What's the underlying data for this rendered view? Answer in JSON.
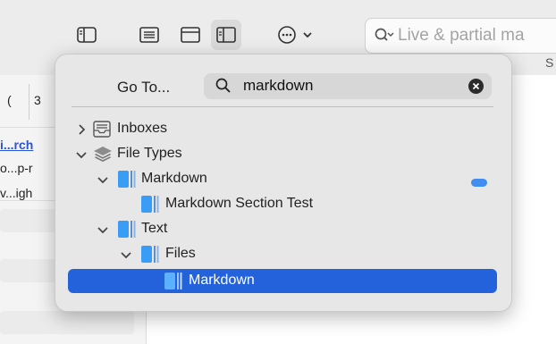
{
  "toolbar": {
    "search_placeholder": "Live & partial ma",
    "right_fragment": "S"
  },
  "background": {
    "tab_fragment_1": "(",
    "tab_fragment_2": "3",
    "link_text": "i...rch",
    "row_2": "o...p-r",
    "row_3": "v...igh"
  },
  "popover": {
    "goto_label": "Go To...",
    "search_value": "markdown",
    "tree": [
      {
        "label": "Inboxes",
        "icon": "inbox-icon",
        "expanded": false
      },
      {
        "label": "File Types",
        "icon": "layers-icon",
        "expanded": true
      },
      {
        "label": "Markdown",
        "icon": "group-icon",
        "expanded": true,
        "tag_color": "#3f8ef0"
      },
      {
        "label": "Markdown Section Test",
        "icon": "group-icon"
      },
      {
        "label": "Text",
        "icon": "group-icon",
        "expanded": true
      },
      {
        "label": "Files",
        "icon": "group-icon",
        "expanded": true
      },
      {
        "label": "Markdown",
        "icon": "group-icon",
        "selected": true
      }
    ]
  },
  "colors": {
    "accent": "#2462dc",
    "folder_blue": "#3a9df5"
  }
}
